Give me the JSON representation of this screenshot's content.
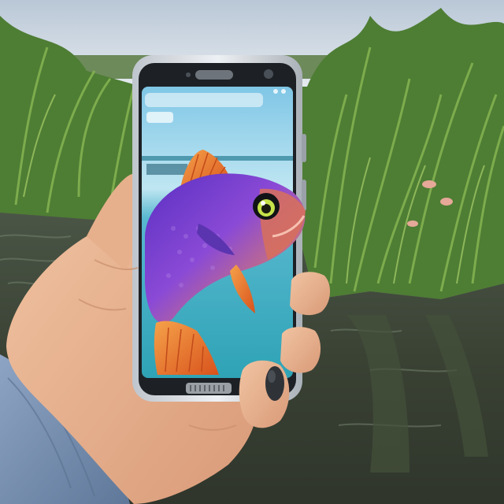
{
  "scene": {
    "description_name": "hand-holding-phone-with-fish",
    "colors": {
      "sky": "#c9d6e2",
      "grass_dark": "#3f6b2c",
      "grass_light": "#7fae4a",
      "water": "#3e4537",
      "skin": "#e9b48f",
      "sleeve": "#7b93b6",
      "phone_body": "#d8dde2",
      "phone_bezel": "#1c2024",
      "screen_sky": "#9fd3ea",
      "screen_water": "#3fb5c7",
      "fish_body": "#7a3fd0",
      "fish_fin": "#f07a2a"
    }
  }
}
